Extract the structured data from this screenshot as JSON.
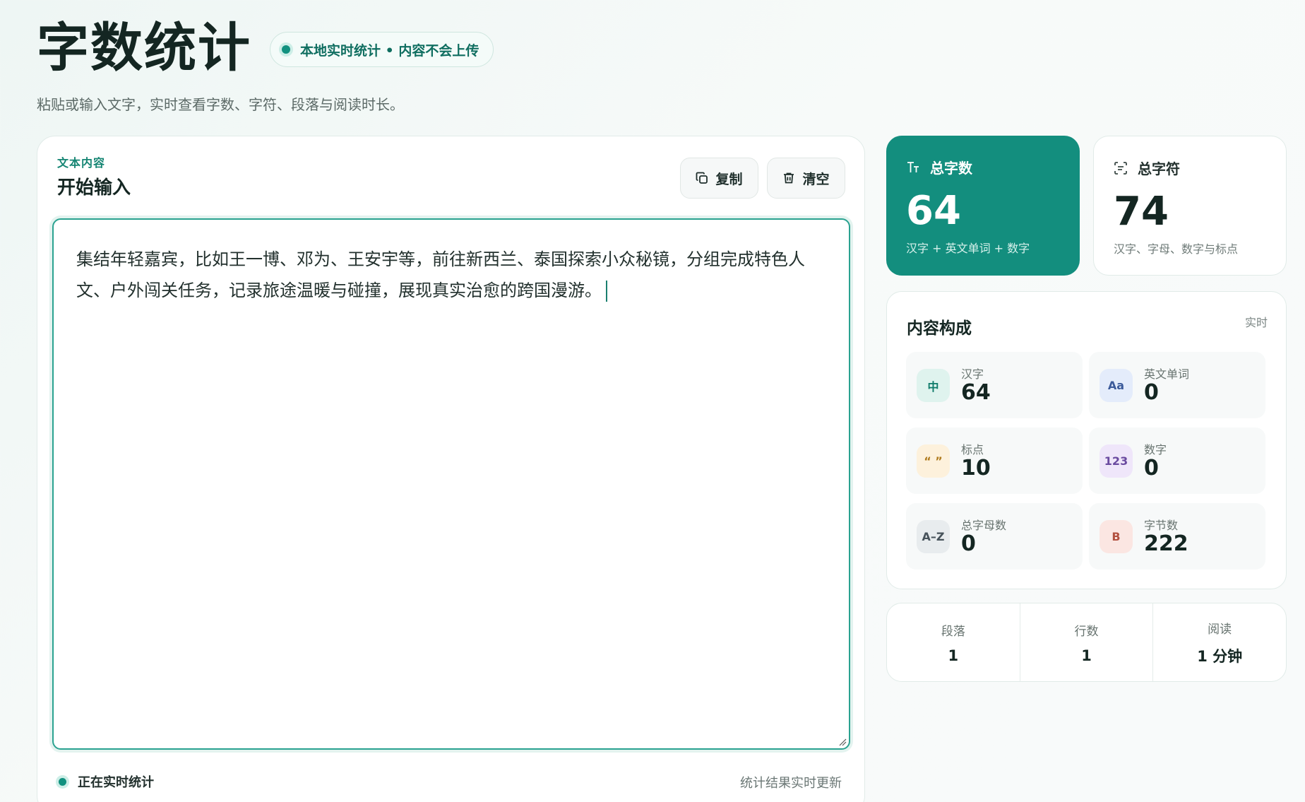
{
  "header": {
    "title": "字数统计",
    "badge": "本地实时统计 • 内容不会上传",
    "subtitle": "粘贴或输入文字，实时查看字数、字符、段落与阅读时长。"
  },
  "editor": {
    "eyebrow": "文本内容",
    "heading": "开始输入",
    "copy_label": "复制",
    "clear_label": "清空",
    "text": "集结年轻嘉宾，比如王一博、邓为、王安宇等，前往新西兰、泰国探索小众秘镜，分组完成特色人文、户外闯关任务，记录旅途温暖与碰撞，展现真实治愈的跨国漫游。",
    "status": "正在实时统计",
    "update_note": "统计结果实时更新"
  },
  "stats": {
    "words": {
      "label": "总字数",
      "value": "64",
      "desc": "汉字 + 英文单词 + 数字"
    },
    "chars": {
      "label": "总字符",
      "value": "74",
      "desc": "汉字、字母、数字与标点"
    }
  },
  "composition": {
    "title": "内容构成",
    "realtime": "实时",
    "items": [
      {
        "label": "汉字",
        "value": "64",
        "icon": "中",
        "icon_name": "hanzi-icon",
        "bg": "#dff3ee",
        "fg": "#0f7b6a"
      },
      {
        "label": "英文单词",
        "value": "0",
        "icon": "Aa",
        "icon_name": "english-icon",
        "bg": "#e4ecfb",
        "fg": "#3b5a9a"
      },
      {
        "label": "标点",
        "value": "10",
        "icon": "“ ”",
        "icon_name": "punctuation-icon",
        "bg": "#fdf1dc",
        "fg": "#b07b1e"
      },
      {
        "label": "数字",
        "value": "0",
        "icon": "123",
        "icon_name": "number-icon",
        "bg": "#efe6fa",
        "fg": "#6a4aa0"
      },
      {
        "label": "总字母数",
        "value": "0",
        "icon": "A–Z",
        "icon_name": "letters-icon",
        "bg": "#e8ecee",
        "fg": "#46525a"
      },
      {
        "label": "字节数",
        "value": "222",
        "icon": "B",
        "icon_name": "bytes-icon",
        "bg": "#fbe6e2",
        "fg": "#b2503f"
      }
    ]
  },
  "meta": [
    {
      "label": "段落",
      "value": "1"
    },
    {
      "label": "行数",
      "value": "1"
    },
    {
      "label": "阅读",
      "value": "1 分钟"
    }
  ]
}
